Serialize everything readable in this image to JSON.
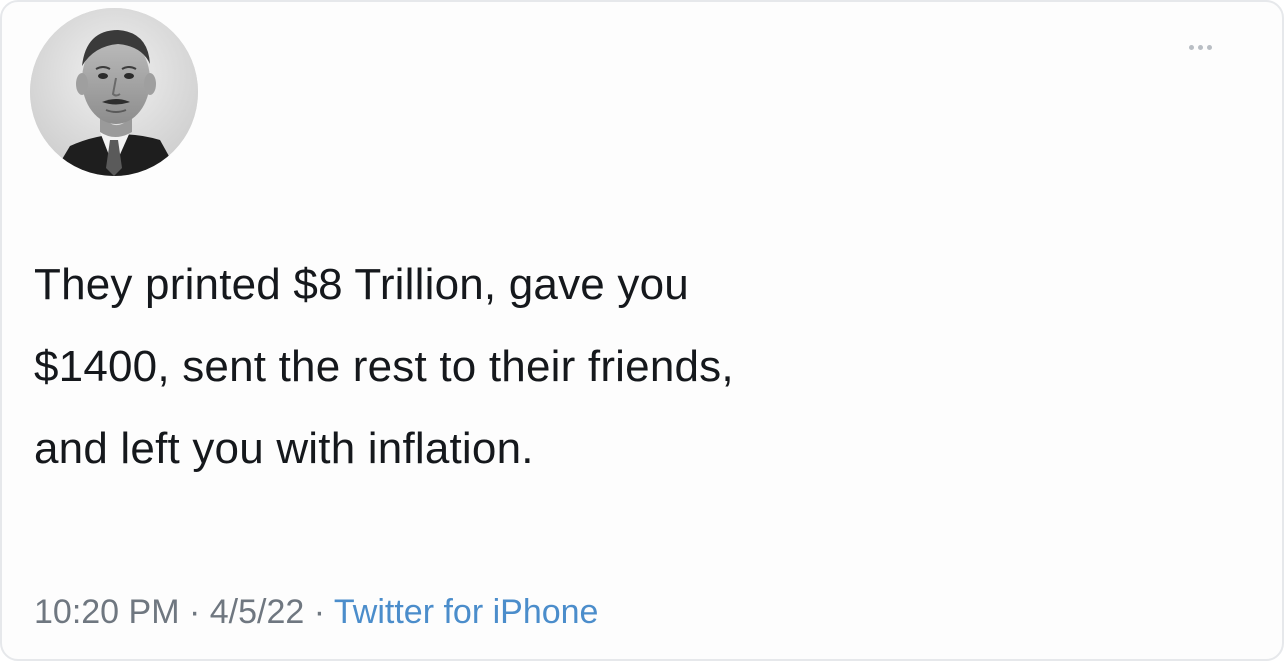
{
  "tweet": {
    "text_lines": [
      "They printed $8 Trillion, gave you",
      "$1400, sent the rest to their friends,",
      "and left you with inflation."
    ],
    "time": "10:20 PM",
    "date": "4/5/22",
    "source": "Twitter for iPhone",
    "separator": " · "
  },
  "icons": {
    "more": "more-horizontal-icon",
    "avatar": "profile-photo"
  }
}
